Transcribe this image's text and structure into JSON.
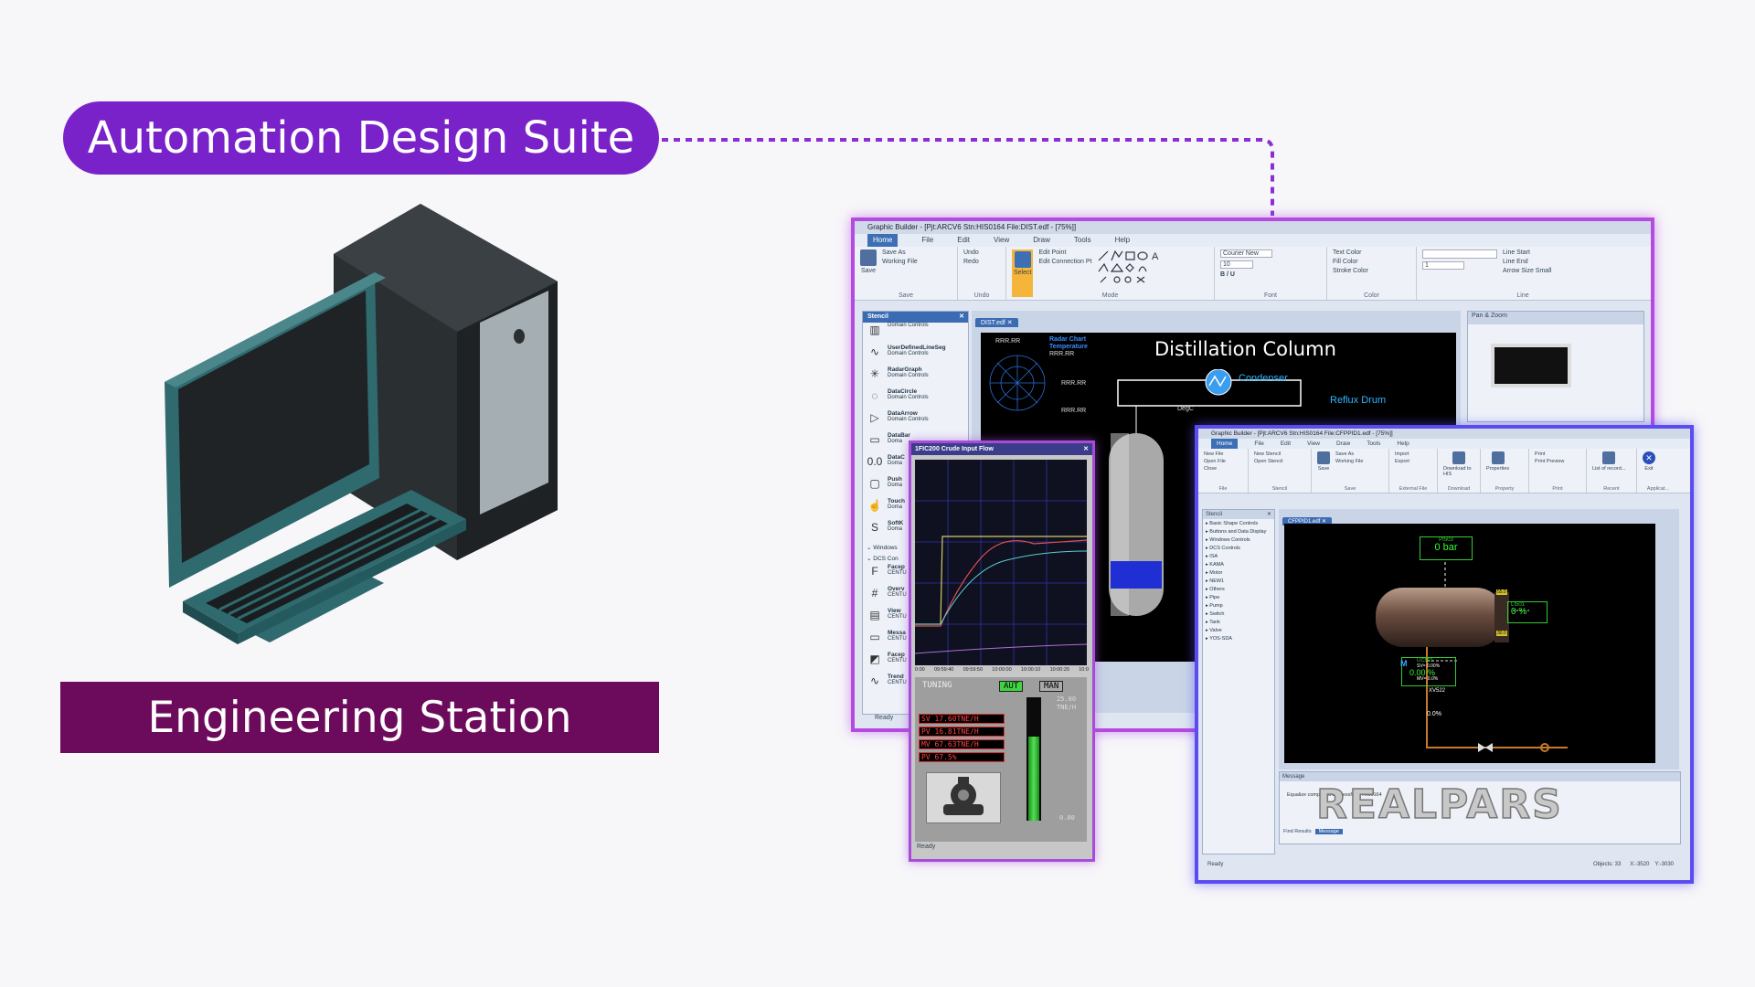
{
  "title": "Automation Design Suite",
  "station_label": "Engineering Station",
  "colors": {
    "pill": "#7a22c9",
    "station": "#6c0b5b",
    "window_border": "#b54ae0",
    "accent": "#3b6bb3"
  },
  "graphic_builder": {
    "title": "Graphic Builder - [Pjt:ARCV6 Stn:HIS0164 File:DIST.edf - [75%]]",
    "menu": [
      "Home",
      "File",
      "Edit",
      "View",
      "Draw",
      "Tools",
      "Help"
    ],
    "ribbon": {
      "save": "Save",
      "save_as": "Save As",
      "working_file": "Working File",
      "group_save": "Save",
      "undo": "Undo",
      "redo": "Redo",
      "group_undo": "Undo",
      "select": "Select",
      "edit_point": "Edit Point",
      "edit_connection": "Edit Connection Pt",
      "group_mode": "Mode",
      "font_name": "Courier New",
      "font_size": "10",
      "group_font": "Font",
      "text_color": "Text Color",
      "fill_color": "Fill Color",
      "stroke_color": "Stroke Color",
      "group_color": "Color",
      "line_start": "Line Start",
      "line_end": "Line End",
      "arrow_size": "Arrow Size",
      "arrow_size_val": "Small",
      "line_width": "1",
      "group_line": "Line"
    },
    "stencil_title": "Stencil",
    "stencil_items": [
      {
        "name": "",
        "sub": "Domain Controls",
        "icon": "bar-icon"
      },
      {
        "name": "UserDefinedLineSeg",
        "sub": "Domain Controls",
        "icon": "line-icon"
      },
      {
        "name": "RadarGraph",
        "sub": "Domain Controls",
        "icon": "radar-icon"
      },
      {
        "name": "DataCircle",
        "sub": "Domain Controls",
        "icon": "circle-icon"
      },
      {
        "name": "DataArrow",
        "sub": "Domain Controls",
        "icon": "arrow-icon"
      },
      {
        "name": "DataBar",
        "sub": "Doma",
        "icon": "databar-icon"
      },
      {
        "name": "DataC",
        "sub": "Doma",
        "icon": "number-icon"
      },
      {
        "name": "Push",
        "sub": "Doma",
        "icon": "button-icon"
      },
      {
        "name": "Touch",
        "sub": "Doma",
        "icon": "touch-icon"
      },
      {
        "name": "SoftK",
        "sub": "Doma",
        "icon": "softkey-icon"
      }
    ],
    "stencil_groups": [
      "Windows",
      "DCS Con"
    ],
    "stencil_items2": [
      {
        "name": "Facep",
        "sub": "CENTU"
      },
      {
        "name": "Overv",
        "sub": "CENTU"
      },
      {
        "name": "View",
        "sub": "CENTU"
      },
      {
        "name": "Messa",
        "sub": "CENTU"
      },
      {
        "name": "Facep",
        "sub": "CENTU"
      },
      {
        "name": "Trend",
        "sub": "CENTU"
      }
    ],
    "status": "Ready",
    "doc_tab": "DIST.edf",
    "canvas_title": "Distillation  Column",
    "condenser": "Condenser",
    "reflux": "Reflux Drum",
    "radar_label1": "Radar Chart",
    "radar_label2": "Temperature",
    "rrr": "RRR.RR",
    "degc": "DegC",
    "pan_zoom": "Pan & Zoom"
  },
  "faceplate": {
    "title": "1FIC200 Crude Input  Flow",
    "times": [
      "0:00",
      "09:59:40",
      "09:59:50",
      "10:00:00",
      "10:00:10",
      "10:00:20",
      "10:0"
    ],
    "tuning": "TUNING",
    "aut": "AUT",
    "man": "MAN",
    "scale_top": "25.00",
    "scale_unit": "TNE/H",
    "scale_bottom": "0.00",
    "rows": [
      {
        "k": "SV",
        "v": "17.60TNE/H"
      },
      {
        "k": "PV",
        "v": "16.81TNE/H"
      },
      {
        "k": "MV",
        "v": "67.63TNE/H"
      },
      {
        "k": "PV",
        "v": "67.5%"
      }
    ],
    "status": "Ready",
    "bar_level": 0.68
  },
  "builder2": {
    "title": "Graphic Builder - [Pjt:ARCV6 Stn:HIS0164 File:CFPPID1.edf - [75%]]",
    "menu": [
      "Home",
      "File",
      "Edit",
      "View",
      "Draw",
      "Tools",
      "Help"
    ],
    "ribbon": {
      "new_file": "New File",
      "open_file": "Open File",
      "close": "Close",
      "group_file": "File",
      "new_stencil": "New Stencil",
      "open_stencil": "Open Stencil",
      "group_stencil": "Stencil",
      "save": "Save",
      "save_as": "Save As",
      "working_file": "Working File",
      "group_save": "Save",
      "import": "Import",
      "export": "Export",
      "group_external": "External File",
      "download": "Download to HIS",
      "group_download": "Download",
      "properties": "Properties",
      "group_property": "Property",
      "print": "Print",
      "print_preview": "Print Preview",
      "group_print": "Print",
      "list_records": "List of record...",
      "group_recent": "Recent",
      "exit": "Exit",
      "group_app": "Applicat..."
    },
    "stencil_title": "Stencil",
    "stencil_groups": [
      "Basic Shape Controls",
      "Buttons and Data Display",
      "Windows Controls",
      "DCS Controls",
      "ISA",
      "KAMA",
      "Motor",
      "NEW1",
      "Others",
      "Pipe",
      "Pump",
      "Switch",
      "Tank",
      "Valve",
      "YOS-SDA"
    ],
    "doc_tab": "CFPPID1.edf",
    "pi": "PI503",
    "pi_val": "0",
    "pi_unit": "bar",
    "li": "LI501",
    "li_val": "0",
    "li_unit": "%",
    "ss_top": "55.0",
    "ss_bot": "30.0",
    "lic": "LIC501",
    "lic_sv": "SV= 0.00%",
    "lic_pv": "0.00",
    "lic_pu": "%",
    "lic_mv": "MV= 0.0%",
    "m": "M",
    "xv": "XV522",
    "xv_pct": "0.0%",
    "message_title": "Message",
    "message_text": "Equalize completed successfully: HIS0164",
    "find_results": "Find Results",
    "message_tab": "Message",
    "status": "Ready",
    "objects": "Objects: 33",
    "coord_x": "X:-3520",
    "coord_y": "Y:-3030"
  },
  "watermark": "REALPARS"
}
